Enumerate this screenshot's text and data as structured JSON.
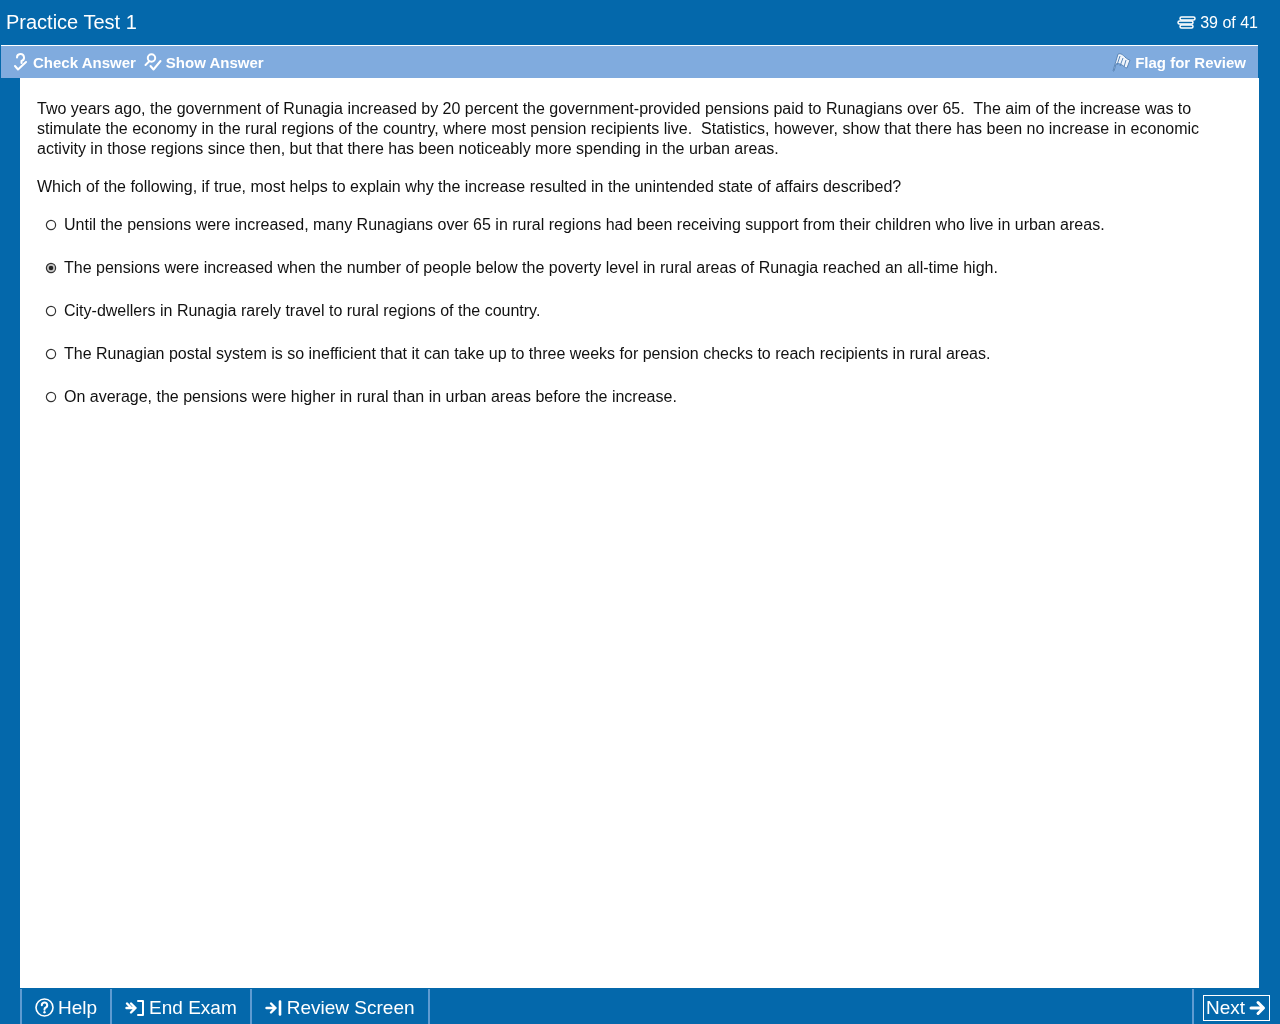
{
  "window": {
    "title": "Practice Test 1",
    "progress": "39 of 41"
  },
  "toolbar": {
    "left": [
      {
        "label": "Check Answer",
        "kind": "check"
      },
      {
        "label": "Show Answer",
        "kind": "show"
      }
    ],
    "right": [
      {
        "label": "Flag for Review",
        "kind": "flag"
      }
    ]
  },
  "question": {
    "stimulus": "Two years ago, the government of Runagia increased by 20 percent the government-provided pensions paid to Runagians over 65.  The aim of the increase was to stimulate the economy in the rural regions of the country, where most pension recipients live.  Statistics, however, show that there has been no increase in economic activity in those regions since then, but that there has been noticeably more spending in the urban areas.",
    "stem": "Which of the following, if true, most helps to explain why the increase resulted in the unintended state of affairs described?",
    "options": [
      {
        "text": "Until the pensions were increased, many Runagians over 65 in rural regions had been receiving support from their children who live in urban areas.",
        "selected": false
      },
      {
        "text": "The pensions were increased when the number of people below the poverty level in rural areas of Runagia reached an all-time high.",
        "selected": true
      },
      {
        "text": "City-dwellers in Runagia rarely travel to rural regions of the country.",
        "selected": false
      },
      {
        "text": "The Runagian postal system is so inefficient that it can take up to three weeks for pension checks to reach recipients in rural areas.",
        "selected": false
      },
      {
        "text": "On average, the pensions were higher in rural than in urban areas before the increase.",
        "selected": false
      }
    ]
  },
  "footer": {
    "left": [
      {
        "label": "Help",
        "kind": "help",
        "focused": false
      },
      {
        "label": "End Exam",
        "kind": "end",
        "focused": false
      },
      {
        "label": "Review Screen",
        "kind": "review",
        "focused": false
      }
    ],
    "right": [
      {
        "label": "Next",
        "kind": "next",
        "focused": true
      }
    ]
  }
}
